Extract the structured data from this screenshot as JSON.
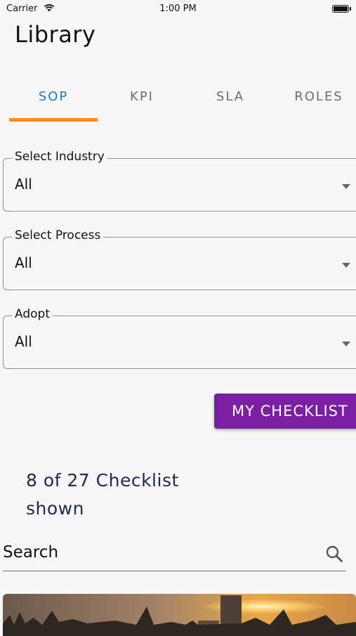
{
  "status_bar": {
    "carrier": "Carrier",
    "time": "1:00 PM"
  },
  "header": {
    "title": "Library"
  },
  "tabs": [
    {
      "label": "SOP",
      "active": true
    },
    {
      "label": "KPI",
      "active": false
    },
    {
      "label": "SLA",
      "active": false
    },
    {
      "label": "ROLES",
      "active": false
    }
  ],
  "filters": {
    "industry": {
      "label": "Select Industry",
      "value": "All"
    },
    "process": {
      "label": "Select Process",
      "value": "All"
    },
    "adopt": {
      "label": "Adopt",
      "value": "All"
    }
  },
  "my_checklist_button": "MY CHECKLIST",
  "shown_count": "8 of 27 Checklist shown",
  "search": {
    "placeholder": "Search"
  },
  "colors": {
    "accent_tab": "#1f7bbf",
    "tab_indicator": "#ff8a1f",
    "button": "#7b1fa2",
    "count_text": "#1c2a5a"
  },
  "icons": {
    "wifi": "wifi-icon",
    "battery": "battery-icon",
    "dropdown": "arrow-drop-down-icon",
    "search": "search-icon"
  }
}
